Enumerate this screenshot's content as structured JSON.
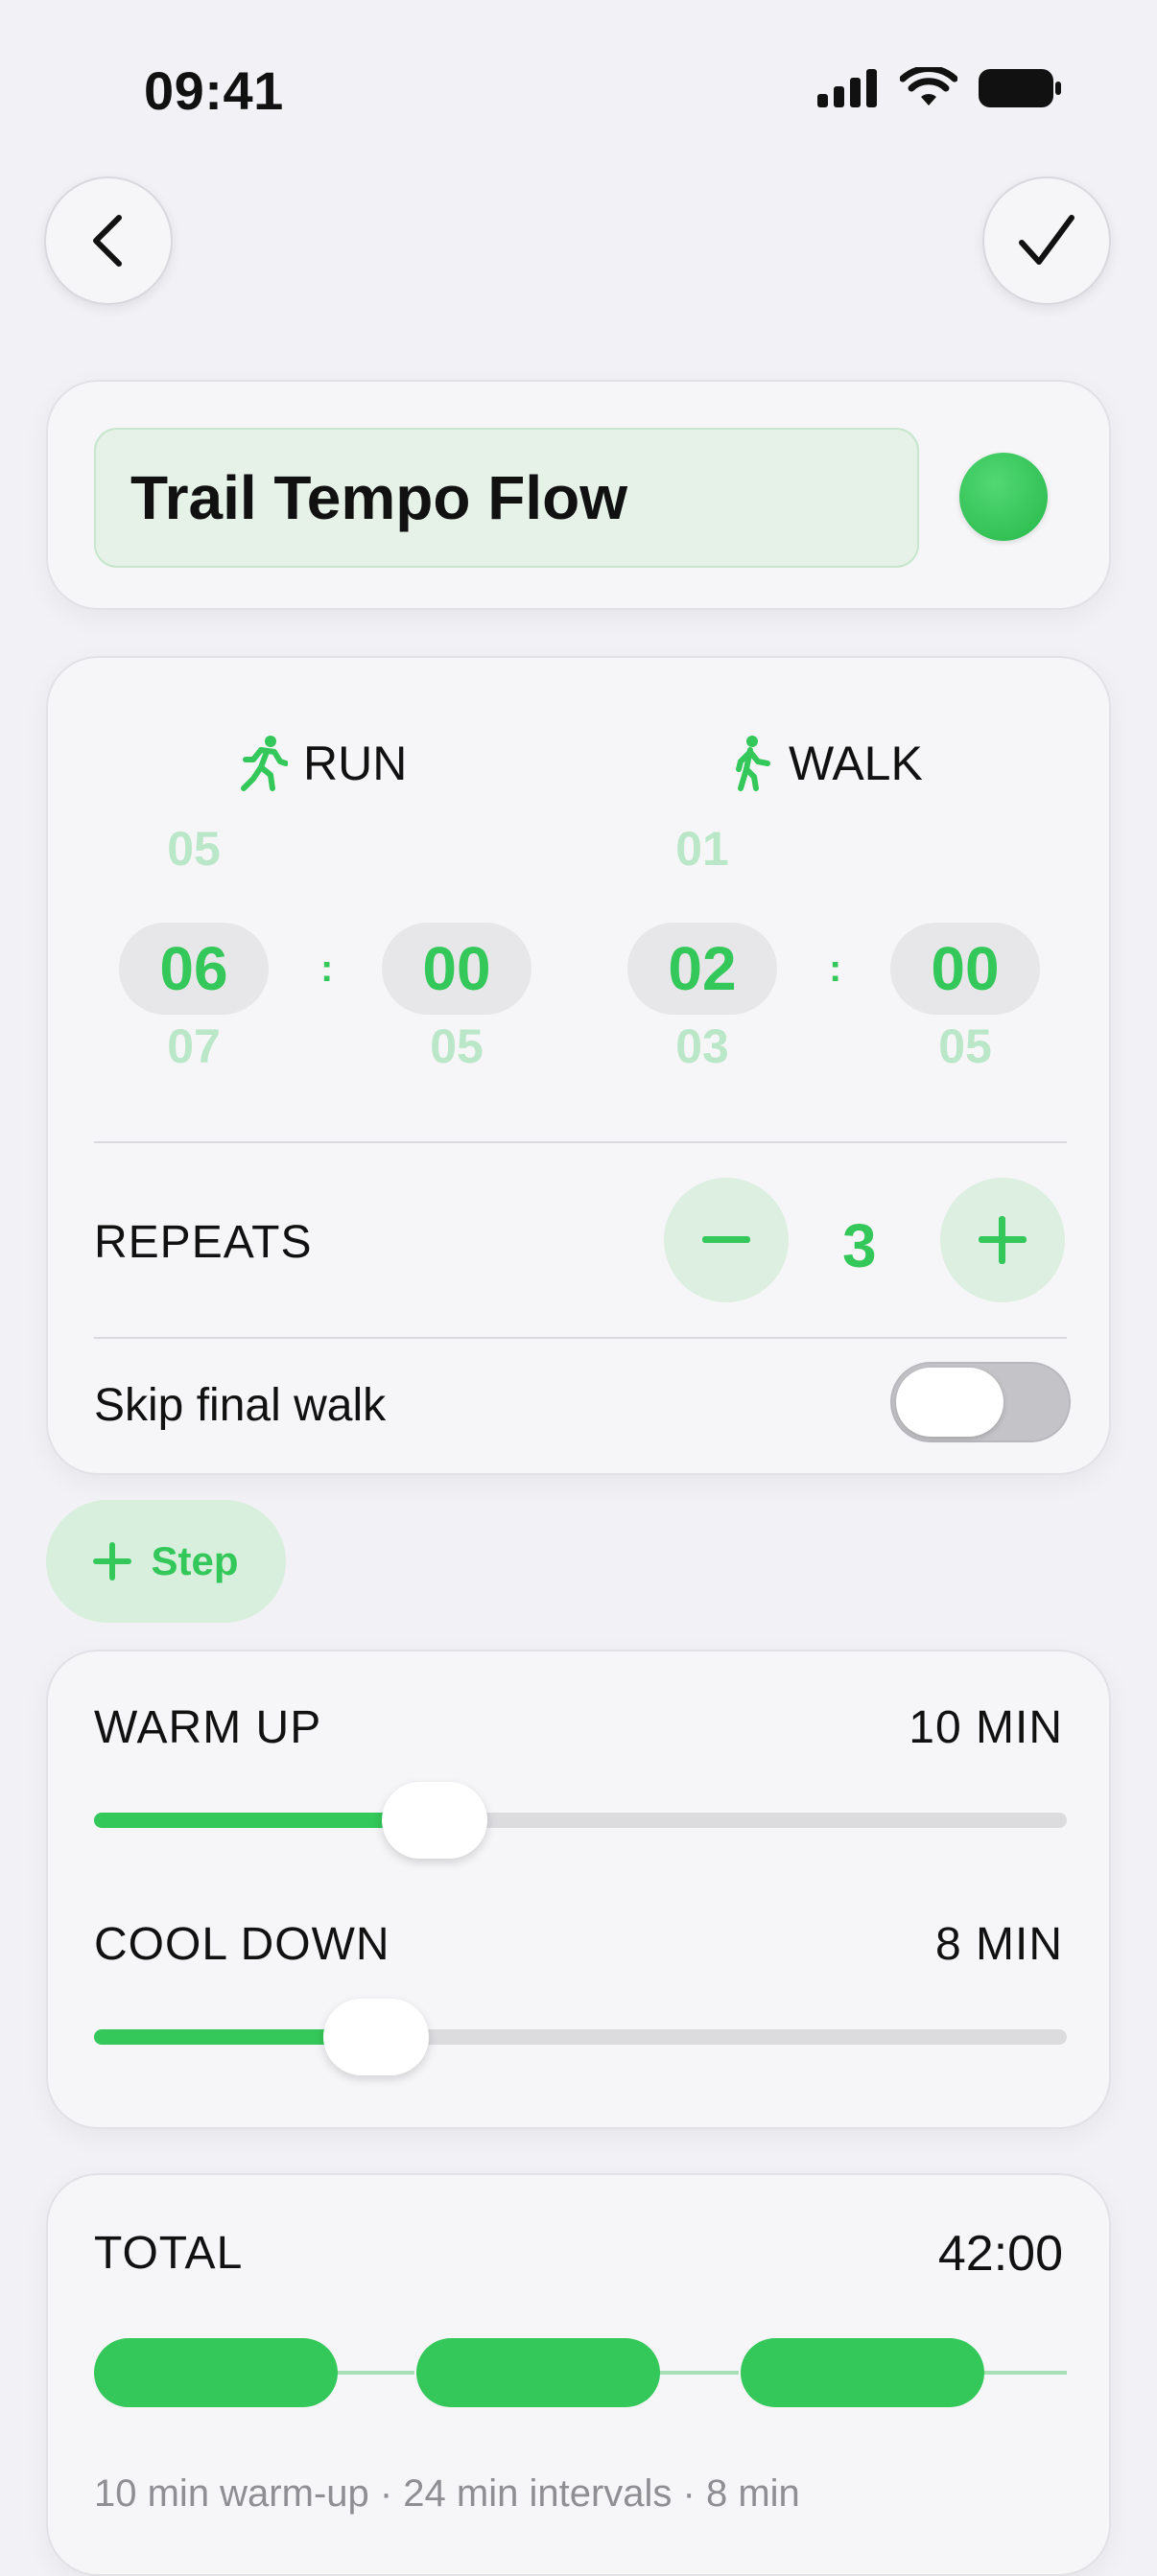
{
  "status_bar": {
    "time": "09:41"
  },
  "nav": {
    "back_icon": "chevron-left-icon",
    "confirm_icon": "checkmark-icon"
  },
  "workout": {
    "name": "Trail Tempo Flow",
    "color": "#34c759"
  },
  "run": {
    "label": "RUN",
    "minutes": {
      "above": "05",
      "selected": "06",
      "below": "07"
    },
    "seconds": {
      "above": "",
      "selected": "00",
      "below": "05"
    }
  },
  "walk": {
    "label": "WALK",
    "minutes": {
      "above": "01",
      "selected": "02",
      "below": "03"
    },
    "seconds": {
      "above": "",
      "selected": "00",
      "below": "05"
    }
  },
  "separator": ":",
  "repeats": {
    "label": "REPEATS",
    "value": "3"
  },
  "skip_final_walk": {
    "label": "Skip final walk",
    "enabled": false
  },
  "add_step": {
    "label": "Step"
  },
  "warm_up": {
    "label": "WARM UP",
    "value_label": "10 MIN",
    "fill_fraction": 0.35
  },
  "cool_down": {
    "label": "COOL DOWN",
    "value_label": "8 MIN",
    "fill_fraction": 0.29
  },
  "total": {
    "label": "TOTAL",
    "value": "42:00",
    "summary": "10 min warm-up · 24 min intervals · 8 min"
  },
  "colors": {
    "accent": "#34c759",
    "accent_light": "#dcefe0",
    "background": "#f2f2f6"
  }
}
